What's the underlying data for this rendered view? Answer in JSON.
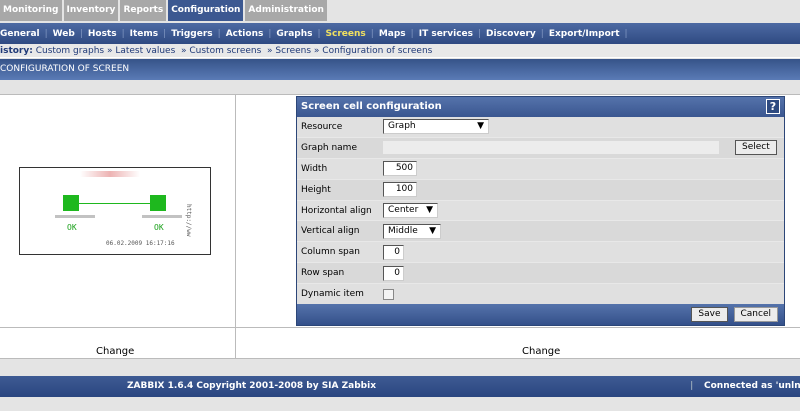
{
  "top_tabs": [
    "Monitoring",
    "Inventory",
    "Reports",
    "Configuration",
    "Administration"
  ],
  "active_tab": "Configuration",
  "nav": [
    "General",
    "Web",
    "Hosts",
    "Items",
    "Triggers",
    "Actions",
    "Graphs",
    "Screens",
    "Maps",
    "IT services",
    "Discovery",
    "Export/Import"
  ],
  "active_nav": "Screens",
  "history": {
    "label": "istory:",
    "items": [
      "Custom graphs",
      "Latest values",
      "Custom screens",
      "Screens",
      "Configuration of screens"
    ]
  },
  "header": "CONFIGURATION OF SCREEN",
  "map": {
    "status1": "OK",
    "status2": "OK",
    "timestamp": "06.02.2009 16:17:16",
    "url": "http://ww"
  },
  "change_left": "Change",
  "change_right": "Change",
  "dialog": {
    "title": "Screen cell configuration",
    "help": "?",
    "resource_label": "Resource",
    "resource": "Graph",
    "graph_name_label": "Graph name",
    "graph_name": "",
    "select": "Select",
    "width_label": "Width",
    "width": "500",
    "height_label": "Height",
    "height": "100",
    "halign_label": "Horizontal align",
    "halign": "Center",
    "valign_label": "Vertical align",
    "valign": "Middle",
    "colspan_label": "Column span",
    "colspan": "0",
    "rowspan_label": "Row span",
    "rowspan": "0",
    "dynamic_label": "Dynamic item",
    "save": "Save",
    "cancel": "Cancel"
  },
  "footer": {
    "copyright": "ZABBIX 1.6.4 Copyright 2001-2008 by  SIA Zabbix",
    "connected": "Connected as 'unlnk"
  }
}
